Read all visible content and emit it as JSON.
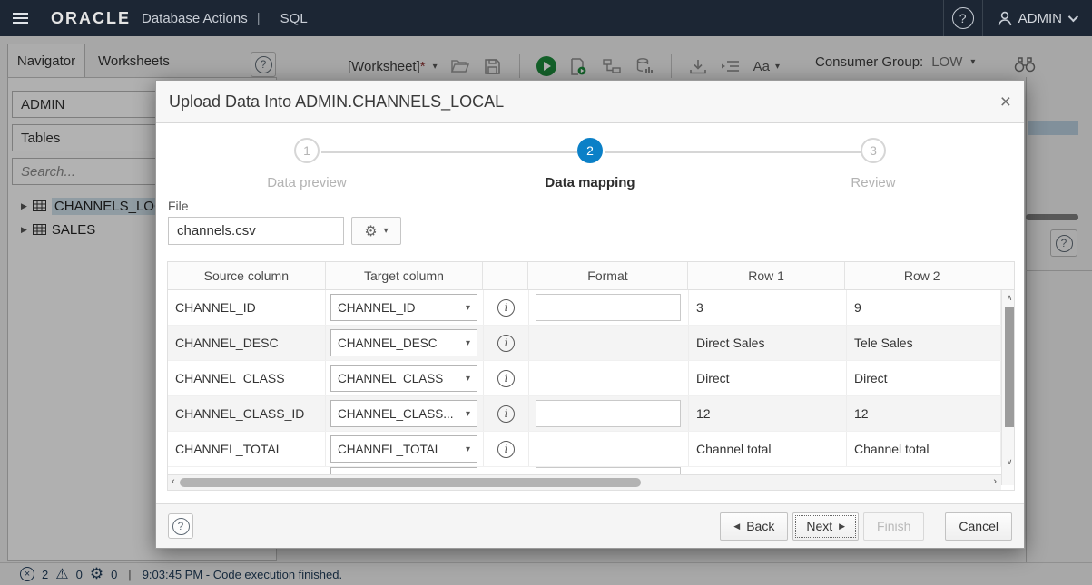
{
  "topbar": {
    "brand": "ORACLE",
    "app_name": "Database Actions",
    "separator": "|",
    "context": "SQL",
    "user": "ADMIN"
  },
  "sidebar": {
    "tabs": [
      {
        "label": "Navigator"
      },
      {
        "label": "Worksheets"
      }
    ],
    "schema_value": "ADMIN",
    "object_type_value": "Tables",
    "search_placeholder": "Search...",
    "tree": [
      {
        "label": "CHANNELS_LOC"
      },
      {
        "label": "SALES"
      }
    ]
  },
  "toolbar": {
    "worksheet_label": "[Worksheet]",
    "dirty_marker": "*",
    "text_size_label": "Aa",
    "consumer_group_label": "Consumer Group:",
    "consumer_group_value": "LOW"
  },
  "modal": {
    "title": "Upload Data Into ADMIN.CHANNELS_LOCAL",
    "close_glyph": "×",
    "steps": [
      {
        "num": "1",
        "label": "Data preview"
      },
      {
        "num": "2",
        "label": "Data mapping"
      },
      {
        "num": "3",
        "label": "Review"
      }
    ],
    "file_label": "File",
    "file_value": "channels.csv",
    "table": {
      "headers": {
        "source": "Source column",
        "target": "Target column",
        "format": "Format",
        "row1": "Row 1",
        "row2": "Row 2"
      },
      "rows": [
        {
          "source": "CHANNEL_ID",
          "target": "CHANNEL_ID",
          "row1": "3",
          "row2": "9"
        },
        {
          "source": "CHANNEL_DESC",
          "target": "CHANNEL_DESC",
          "row1": "Direct Sales",
          "row2": "Tele Sales"
        },
        {
          "source": "CHANNEL_CLASS",
          "target": "CHANNEL_CLASS",
          "row1": "Direct",
          "row2": "Direct"
        },
        {
          "source": "CHANNEL_CLASS_ID",
          "target": "CHANNEL_CLASS...",
          "row1": "12",
          "row2": "12"
        },
        {
          "source": "CHANNEL_TOTAL",
          "target": "CHANNEL_TOTAL",
          "row1": "Channel total",
          "row2": "Channel total"
        }
      ]
    },
    "footer": {
      "back": "Back",
      "next": "Next",
      "finish": "Finish",
      "cancel": "Cancel"
    }
  },
  "statusbar": {
    "errors_count": "2",
    "warnings_count": "0",
    "processes_count": "0",
    "separator": "|",
    "message": "9:03:45 PM - Code execution finished."
  },
  "glyphs": {
    "question": "?",
    "gear": "⚙",
    "warning": "⚠",
    "x": "×",
    "caret_down": "▾",
    "tree_expand": "▶",
    "back_tri": "◀",
    "next_tri": "▶",
    "info_i": "i",
    "sb_left": "‹",
    "sb_right": "›",
    "sb_up": "∧",
    "sb_down": "∨"
  },
  "colors": {
    "header_bg": "#1c2634",
    "accent_blue": "#0b80c7",
    "run_green": "#1c8a3c",
    "selection_blue": "#cfe0ea"
  }
}
